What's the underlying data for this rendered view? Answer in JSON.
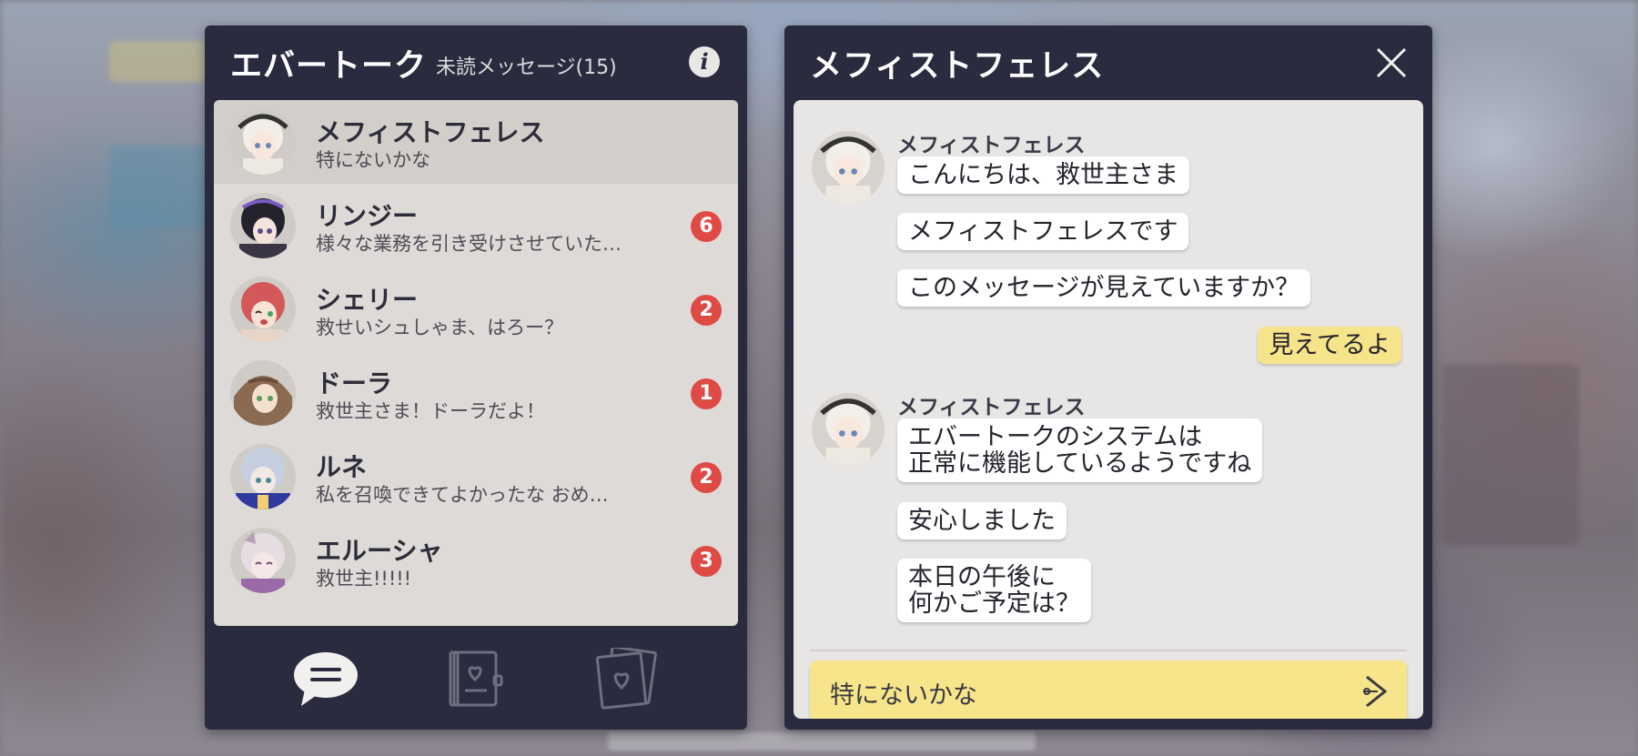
{
  "header": {
    "app_title": "エバートーク",
    "unread_label": "未読メッセージ(15)",
    "info_icon": "info-icon",
    "info_glyph": "i"
  },
  "contacts": [
    {
      "name": "メフィストフェレス",
      "preview": "特にないかな",
      "badge": null,
      "active": true,
      "avatar": "mephistopheles-avatar"
    },
    {
      "name": "リンジー",
      "preview": "様々な業務を引き受けさせていた…",
      "badge": "6",
      "active": false,
      "avatar": "lindsey-avatar"
    },
    {
      "name": "シェリー",
      "preview": "救せいシュしゃま、はろー？",
      "badge": "2",
      "active": false,
      "avatar": "shelley-avatar"
    },
    {
      "name": "ドーラ",
      "preview": "救世主さま！ドーラだよ！",
      "badge": "1",
      "active": false,
      "avatar": "dora-avatar"
    },
    {
      "name": "ルネ",
      "preview": "私を召喚できてよかったな おめ…",
      "badge": "2",
      "active": false,
      "avatar": "rune-avatar"
    },
    {
      "name": "エルーシャ",
      "preview": "救世主!!!!!",
      "badge": "3",
      "active": false,
      "avatar": "elusha-avatar"
    }
  ],
  "tabs": [
    {
      "icon": "chat-bubble-icon",
      "active": true
    },
    {
      "icon": "heart-book-icon",
      "active": false
    },
    {
      "icon": "heart-photos-icon",
      "active": false
    }
  ],
  "chat": {
    "title": "メフィストフェレス",
    "close_icon": "close-icon",
    "groups": [
      {
        "sender": "メフィストフェレス",
        "messages": [
          "こんにちは、救世主さま",
          "メフィストフェレスです",
          "このメッセージが見えていますか？"
        ]
      },
      {
        "sender": "me",
        "messages": [
          "見えてるよ"
        ]
      },
      {
        "sender": "メフィストフェレス",
        "messages": [
          "エバートークのシステムは\n正常に機能しているようですね",
          "安心しました",
          "本日の午後に\n何かご予定は？"
        ]
      }
    ],
    "reply_option": "特にないかな",
    "send_icon": "send-arrow-icon"
  },
  "colors": {
    "panel_bg": "#2b2b3f",
    "list_bg": "#dedad8",
    "badge_red": "#e04a45",
    "my_bubble": "#f6e48a",
    "reply_yellow": "#f7e58b"
  }
}
